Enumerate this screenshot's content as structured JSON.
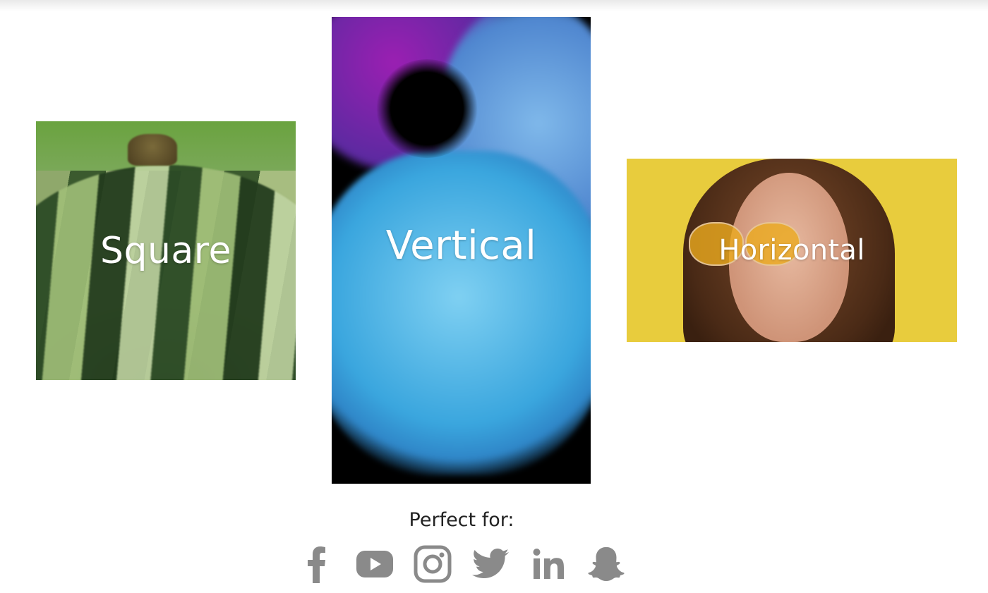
{
  "cards": {
    "square": {
      "label": "Square"
    },
    "vertical": {
      "label": "Vertical"
    },
    "horizontal": {
      "label": "Horizontal"
    }
  },
  "perfect_for": {
    "heading": "Perfect for:",
    "icons": [
      "facebook-icon",
      "youtube-icon",
      "instagram-icon",
      "twitter-icon",
      "linkedin-icon",
      "snapchat-icon"
    ]
  },
  "colors": {
    "icon_gray": "#8a8a8a",
    "text_dark": "#222222",
    "horizontal_bg": "#e8cc3d"
  }
}
